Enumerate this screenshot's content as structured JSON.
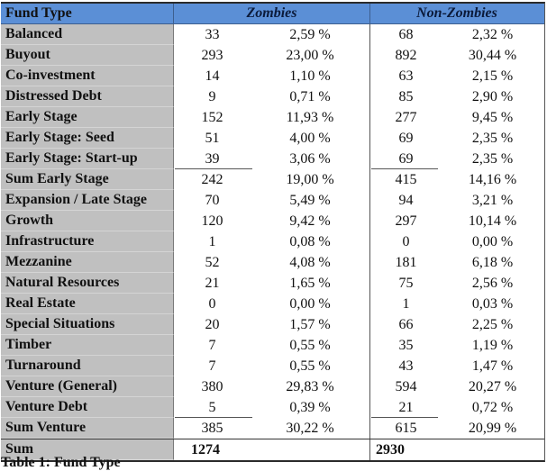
{
  "table": {
    "header": {
      "label": "Fund Type",
      "group_zombies": "Zombies",
      "group_non_zombies": "Non-Zombies"
    },
    "rows": [
      {
        "label": "Balanced",
        "z_count": "33",
        "z_pct": "2,59 %",
        "n_count": "68",
        "n_pct": "2,32 %"
      },
      {
        "label": "Buyout",
        "z_count": "293",
        "z_pct": "23,00 %",
        "n_count": "892",
        "n_pct": "30,44 %"
      },
      {
        "label": "Co-investment",
        "z_count": "14",
        "z_pct": "1,10 %",
        "n_count": "63",
        "n_pct": "2,15 %"
      },
      {
        "label": "Distressed Debt",
        "z_count": "9",
        "z_pct": "0,71 %",
        "n_count": "85",
        "n_pct": "2,90 %"
      },
      {
        "label": "Early Stage",
        "z_count": "152",
        "z_pct": "11,93 %",
        "n_count": "277",
        "n_pct": "9,45 %"
      },
      {
        "label": "Early Stage: Seed",
        "z_count": "51",
        "z_pct": "4,00 %",
        "n_count": "69",
        "n_pct": "2,35 %"
      },
      {
        "label": "Early Stage: Start-up",
        "z_count": "39",
        "z_pct": "3,06 %",
        "n_count": "69",
        "n_pct": "2,35 %"
      },
      {
        "label": "Sum Early Stage",
        "z_count": "242",
        "z_pct": "19,00 %",
        "n_count": "415",
        "n_pct": "14,16 %"
      },
      {
        "label": "Expansion / Late Stage",
        "z_count": "70",
        "z_pct": "5,49 %",
        "n_count": "94",
        "n_pct": "3,21 %"
      },
      {
        "label": "Growth",
        "z_count": "120",
        "z_pct": "9,42 %",
        "n_count": "297",
        "n_pct": "10,14 %"
      },
      {
        "label": "Infrastructure",
        "z_count": "1",
        "z_pct": "0,08 %",
        "n_count": "0",
        "n_pct": "0,00 %"
      },
      {
        "label": "Mezzanine",
        "z_count": "52",
        "z_pct": "4,08 %",
        "n_count": "181",
        "n_pct": "6,18 %"
      },
      {
        "label": "Natural Resources",
        "z_count": "21",
        "z_pct": "1,65 %",
        "n_count": "75",
        "n_pct": "2,56 %"
      },
      {
        "label": "Real Estate",
        "z_count": "0",
        "z_pct": "0,00 %",
        "n_count": "1",
        "n_pct": "0,03 %"
      },
      {
        "label": "Special Situations",
        "z_count": "20",
        "z_pct": "1,57 %",
        "n_count": "66",
        "n_pct": "2,25 %"
      },
      {
        "label": "Timber",
        "z_count": "7",
        "z_pct": "0,55 %",
        "n_count": "35",
        "n_pct": "1,19 %"
      },
      {
        "label": "Turnaround",
        "z_count": "7",
        "z_pct": "0,55 %",
        "n_count": "43",
        "n_pct": "1,47 %"
      },
      {
        "label": "Venture (General)",
        "z_count": "380",
        "z_pct": "29,83 %",
        "n_count": "594",
        "n_pct": "20,27 %"
      },
      {
        "label": "Venture Debt",
        "z_count": "5",
        "z_pct": "0,39 %",
        "n_count": "21",
        "n_pct": "0,72 %"
      },
      {
        "label": "Sum Venture",
        "z_count": "385",
        "z_pct": "30,22 %",
        "n_count": "615",
        "n_pct": "20,99 %"
      }
    ],
    "sum_row": {
      "label": "Sum",
      "z_count": "1274",
      "n_count": "2930"
    },
    "underline_after_rows": [
      6,
      18
    ]
  },
  "caption": "Table 1: Fund Type",
  "colors": {
    "header_bg": "#5b8fd6",
    "label_col_bg": "#c0c0c0"
  }
}
